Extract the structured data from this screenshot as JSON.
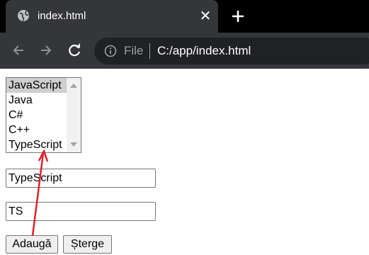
{
  "browser": {
    "tab_title": "index.html",
    "url_scheme": "File",
    "url": "C:/app/index.html",
    "colors": {
      "tabstrip": "#000000",
      "toolbar": "#35363a",
      "omnibox": "#202124"
    }
  },
  "page": {
    "listbox": {
      "options": [
        "JavaScript",
        "Java",
        "C#",
        "C++",
        "TypeScript"
      ],
      "selected": "JavaScript"
    },
    "name_input": {
      "value": "TypeScript"
    },
    "abbr_input": {
      "value": "TS"
    },
    "buttons": {
      "add": "Adaugă",
      "delete": "Șterge"
    },
    "annotation_arrow_color": "#e0202a"
  }
}
